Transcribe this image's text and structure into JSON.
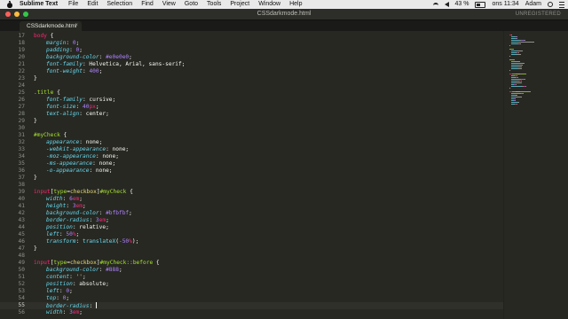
{
  "menubar": {
    "app_name": "Sublime Text",
    "items": [
      "File",
      "Edit",
      "Selection",
      "Find",
      "View",
      "Goto",
      "Tools",
      "Project",
      "Window",
      "Help"
    ],
    "battery": "43 %",
    "clock": "ons 11:34",
    "user": "Adam"
  },
  "window": {
    "title": "CSSdarkmode.html",
    "unregistered": "UNREGISTERED",
    "lights": [
      "#fc605c",
      "#fdbc40",
      "#34c84a"
    ]
  },
  "tab": {
    "label": "CSSdarkmode.html",
    "close": "×"
  },
  "editor": {
    "current_line": 55,
    "lines": [
      {
        "n": "17",
        "i": 0,
        "t": [
          [
            "sel",
            "body"
          ],
          [
            "pun",
            " {"
          ]
        ]
      },
      {
        "n": "18",
        "i": 1,
        "t": [
          [
            "prop",
            "margin"
          ],
          [
            "pun",
            ": "
          ],
          [
            "num",
            "0"
          ],
          [
            "pun",
            ";"
          ]
        ]
      },
      {
        "n": "19",
        "i": 1,
        "t": [
          [
            "prop",
            "padding"
          ],
          [
            "pun",
            ": "
          ],
          [
            "num",
            "0"
          ],
          [
            "pun",
            ";"
          ]
        ]
      },
      {
        "n": "20",
        "i": 1,
        "t": [
          [
            "prop",
            "background-color"
          ],
          [
            "pun",
            ": "
          ],
          [
            "num",
            "#e0e0e0"
          ],
          [
            "pun",
            ";"
          ]
        ]
      },
      {
        "n": "21",
        "i": 1,
        "t": [
          [
            "prop",
            "font-family"
          ],
          [
            "pun",
            ": Helvetica, Arial, sans-serif;"
          ]
        ]
      },
      {
        "n": "22",
        "i": 1,
        "t": [
          [
            "prop",
            "font-weight"
          ],
          [
            "pun",
            ": "
          ],
          [
            "num",
            "400"
          ],
          [
            "pun",
            ";"
          ]
        ]
      },
      {
        "n": "23",
        "i": 0,
        "t": [
          [
            "pun",
            "}"
          ]
        ]
      },
      {
        "n": "24",
        "i": 0,
        "t": []
      },
      {
        "n": "25",
        "i": 0,
        "t": [
          [
            "attr",
            ".title"
          ],
          [
            "pun",
            " {"
          ]
        ]
      },
      {
        "n": "26",
        "i": 1,
        "t": [
          [
            "prop",
            "font-family"
          ],
          [
            "pun",
            ": cursive;"
          ]
        ]
      },
      {
        "n": "27",
        "i": 1,
        "t": [
          [
            "prop",
            "font-size"
          ],
          [
            "pun",
            ": "
          ],
          [
            "num",
            "40"
          ],
          [
            "unit",
            "px"
          ],
          [
            "pun",
            ";"
          ]
        ]
      },
      {
        "n": "28",
        "i": 1,
        "t": [
          [
            "prop",
            "text-align"
          ],
          [
            "pun",
            ": center;"
          ]
        ]
      },
      {
        "n": "29",
        "i": 0,
        "t": [
          [
            "pun",
            "}"
          ]
        ]
      },
      {
        "n": "30",
        "i": 0,
        "t": []
      },
      {
        "n": "31",
        "i": 0,
        "t": [
          [
            "attr",
            "#myCheck"
          ],
          [
            "pun",
            " {"
          ]
        ]
      },
      {
        "n": "32",
        "i": 1,
        "t": [
          [
            "prop",
            "appearance"
          ],
          [
            "pun",
            ": none;"
          ]
        ]
      },
      {
        "n": "33",
        "i": 1,
        "t": [
          [
            "prop",
            "-webkit-appearance"
          ],
          [
            "pun",
            ": none;"
          ]
        ]
      },
      {
        "n": "34",
        "i": 1,
        "t": [
          [
            "prop",
            "-moz-appearance"
          ],
          [
            "pun",
            ": none;"
          ]
        ]
      },
      {
        "n": "35",
        "i": 1,
        "t": [
          [
            "prop",
            "-ms-appearance"
          ],
          [
            "pun",
            ": none;"
          ]
        ]
      },
      {
        "n": "36",
        "i": 1,
        "t": [
          [
            "prop",
            "-o-appearance"
          ],
          [
            "pun",
            ": none;"
          ]
        ]
      },
      {
        "n": "37",
        "i": 0,
        "t": [
          [
            "pun",
            "}"
          ]
        ]
      },
      {
        "n": "38",
        "i": 0,
        "t": []
      },
      {
        "n": "39",
        "i": 0,
        "t": [
          [
            "sel",
            "input"
          ],
          [
            "pun",
            "["
          ],
          [
            "attr",
            "type"
          ],
          [
            "pun",
            "="
          ],
          [
            "str",
            "checkbox"
          ],
          [
            "pun",
            "]"
          ],
          [
            "attr",
            "#myCheck"
          ],
          [
            "pun",
            " {"
          ]
        ]
      },
      {
        "n": "40",
        "i": 1,
        "t": [
          [
            "prop",
            "width"
          ],
          [
            "pun",
            ": "
          ],
          [
            "num",
            "6"
          ],
          [
            "unit",
            "em"
          ],
          [
            "pun",
            ";"
          ]
        ]
      },
      {
        "n": "41",
        "i": 1,
        "t": [
          [
            "prop",
            "height"
          ],
          [
            "pun",
            ": "
          ],
          [
            "num",
            "3"
          ],
          [
            "unit",
            "em"
          ],
          [
            "pun",
            ";"
          ]
        ]
      },
      {
        "n": "42",
        "i": 1,
        "t": [
          [
            "prop",
            "background-color"
          ],
          [
            "pun",
            ": "
          ],
          [
            "num",
            "#bfbfbf"
          ],
          [
            "pun",
            ";"
          ]
        ]
      },
      {
        "n": "43",
        "i": 1,
        "t": [
          [
            "prop",
            "border-radius"
          ],
          [
            "pun",
            ": "
          ],
          [
            "num",
            "3"
          ],
          [
            "unit",
            "em"
          ],
          [
            "pun",
            ";"
          ]
        ]
      },
      {
        "n": "44",
        "i": 1,
        "t": [
          [
            "prop",
            "position"
          ],
          [
            "pun",
            ": relative;"
          ]
        ]
      },
      {
        "n": "45",
        "i": 1,
        "t": [
          [
            "prop",
            "left"
          ],
          [
            "pun",
            ": "
          ],
          [
            "num",
            "50"
          ],
          [
            "unit",
            "%"
          ],
          [
            "pun",
            ";"
          ]
        ]
      },
      {
        "n": "46",
        "i": 1,
        "t": [
          [
            "prop",
            "transform"
          ],
          [
            "pun",
            ": "
          ],
          [
            "fn",
            "translateX"
          ],
          [
            "pun",
            "("
          ],
          [
            "num",
            "-50"
          ],
          [
            "unit",
            "%"
          ],
          [
            "pun",
            ");"
          ]
        ]
      },
      {
        "n": "47",
        "i": 0,
        "t": [
          [
            "pun",
            "}"
          ]
        ]
      },
      {
        "n": "48",
        "i": 0,
        "t": []
      },
      {
        "n": "49",
        "i": 0,
        "t": [
          [
            "sel",
            "input"
          ],
          [
            "pun",
            "["
          ],
          [
            "attr",
            "type"
          ],
          [
            "pun",
            "="
          ],
          [
            "str",
            "checkbox"
          ],
          [
            "pun",
            "]"
          ],
          [
            "attr",
            "#myCheck"
          ],
          [
            "pseudo",
            "::before"
          ],
          [
            "pun",
            " {"
          ]
        ]
      },
      {
        "n": "50",
        "i": 1,
        "t": [
          [
            "prop",
            "background-color"
          ],
          [
            "pun",
            ": "
          ],
          [
            "num",
            "#888"
          ],
          [
            "pun",
            ";"
          ]
        ]
      },
      {
        "n": "51",
        "i": 1,
        "t": [
          [
            "prop",
            "content"
          ],
          [
            "pun",
            ": "
          ],
          [
            "str",
            "''"
          ],
          [
            "pun",
            ";"
          ]
        ]
      },
      {
        "n": "52",
        "i": 1,
        "t": [
          [
            "prop",
            "position"
          ],
          [
            "pun",
            ": absolute;"
          ]
        ]
      },
      {
        "n": "53",
        "i": 1,
        "t": [
          [
            "prop",
            "left"
          ],
          [
            "pun",
            ": "
          ],
          [
            "num",
            "0"
          ],
          [
            "pun",
            ";"
          ]
        ]
      },
      {
        "n": "54",
        "i": 1,
        "t": [
          [
            "prop",
            "top"
          ],
          [
            "pun",
            ": "
          ],
          [
            "num",
            "0"
          ],
          [
            "pun",
            ";"
          ]
        ]
      },
      {
        "n": "55",
        "i": 1,
        "t": [
          [
            "prop",
            "border-radius"
          ],
          [
            "pun",
            ": "
          ]
        ]
      },
      {
        "n": "56",
        "i": 1,
        "t": [
          [
            "prop",
            "width"
          ],
          [
            "pun",
            ": "
          ],
          [
            "num",
            "3"
          ],
          [
            "unit",
            "em"
          ],
          [
            "pun",
            ";"
          ]
        ]
      }
    ]
  }
}
